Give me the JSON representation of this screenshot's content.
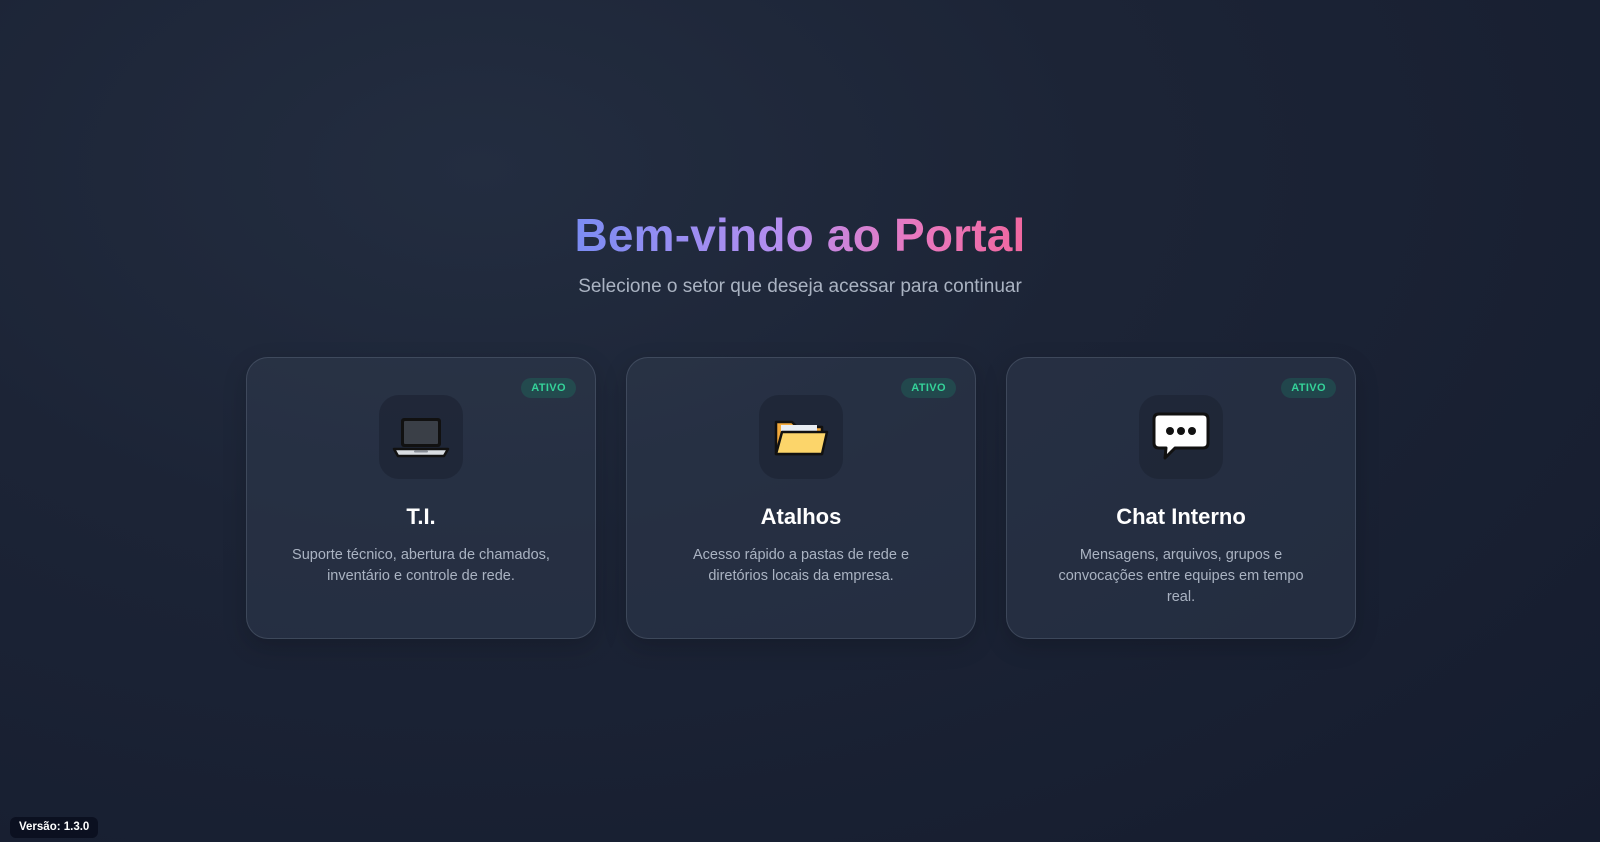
{
  "hero": {
    "title": "Bem-vindo ao Portal",
    "subtitle": "Selecione o setor que deseja acessar para continuar"
  },
  "cards": [
    {
      "icon": "laptop-icon",
      "badge": "ATIVO",
      "title": "T.I.",
      "description": "Suporte técnico, abertura de chamados, inventário e controle de rede."
    },
    {
      "icon": "folder-icon",
      "badge": "ATIVO",
      "title": "Atalhos",
      "description": "Acesso rápido a pastas de rede e diretórios locais da empresa."
    },
    {
      "icon": "speech-bubble-icon",
      "badge": "ATIVO",
      "title": "Chat Interno",
      "description": "Mensagens, arquivos, grupos e convocações entre equipes em tempo real."
    }
  ],
  "footer": {
    "version": "Versão: 1.3.0"
  },
  "colors": {
    "background": "#1c2436",
    "badge_text": "#34d399",
    "title_gradient_start": "#7b8cf3",
    "title_gradient_end": "#f0679f"
  }
}
